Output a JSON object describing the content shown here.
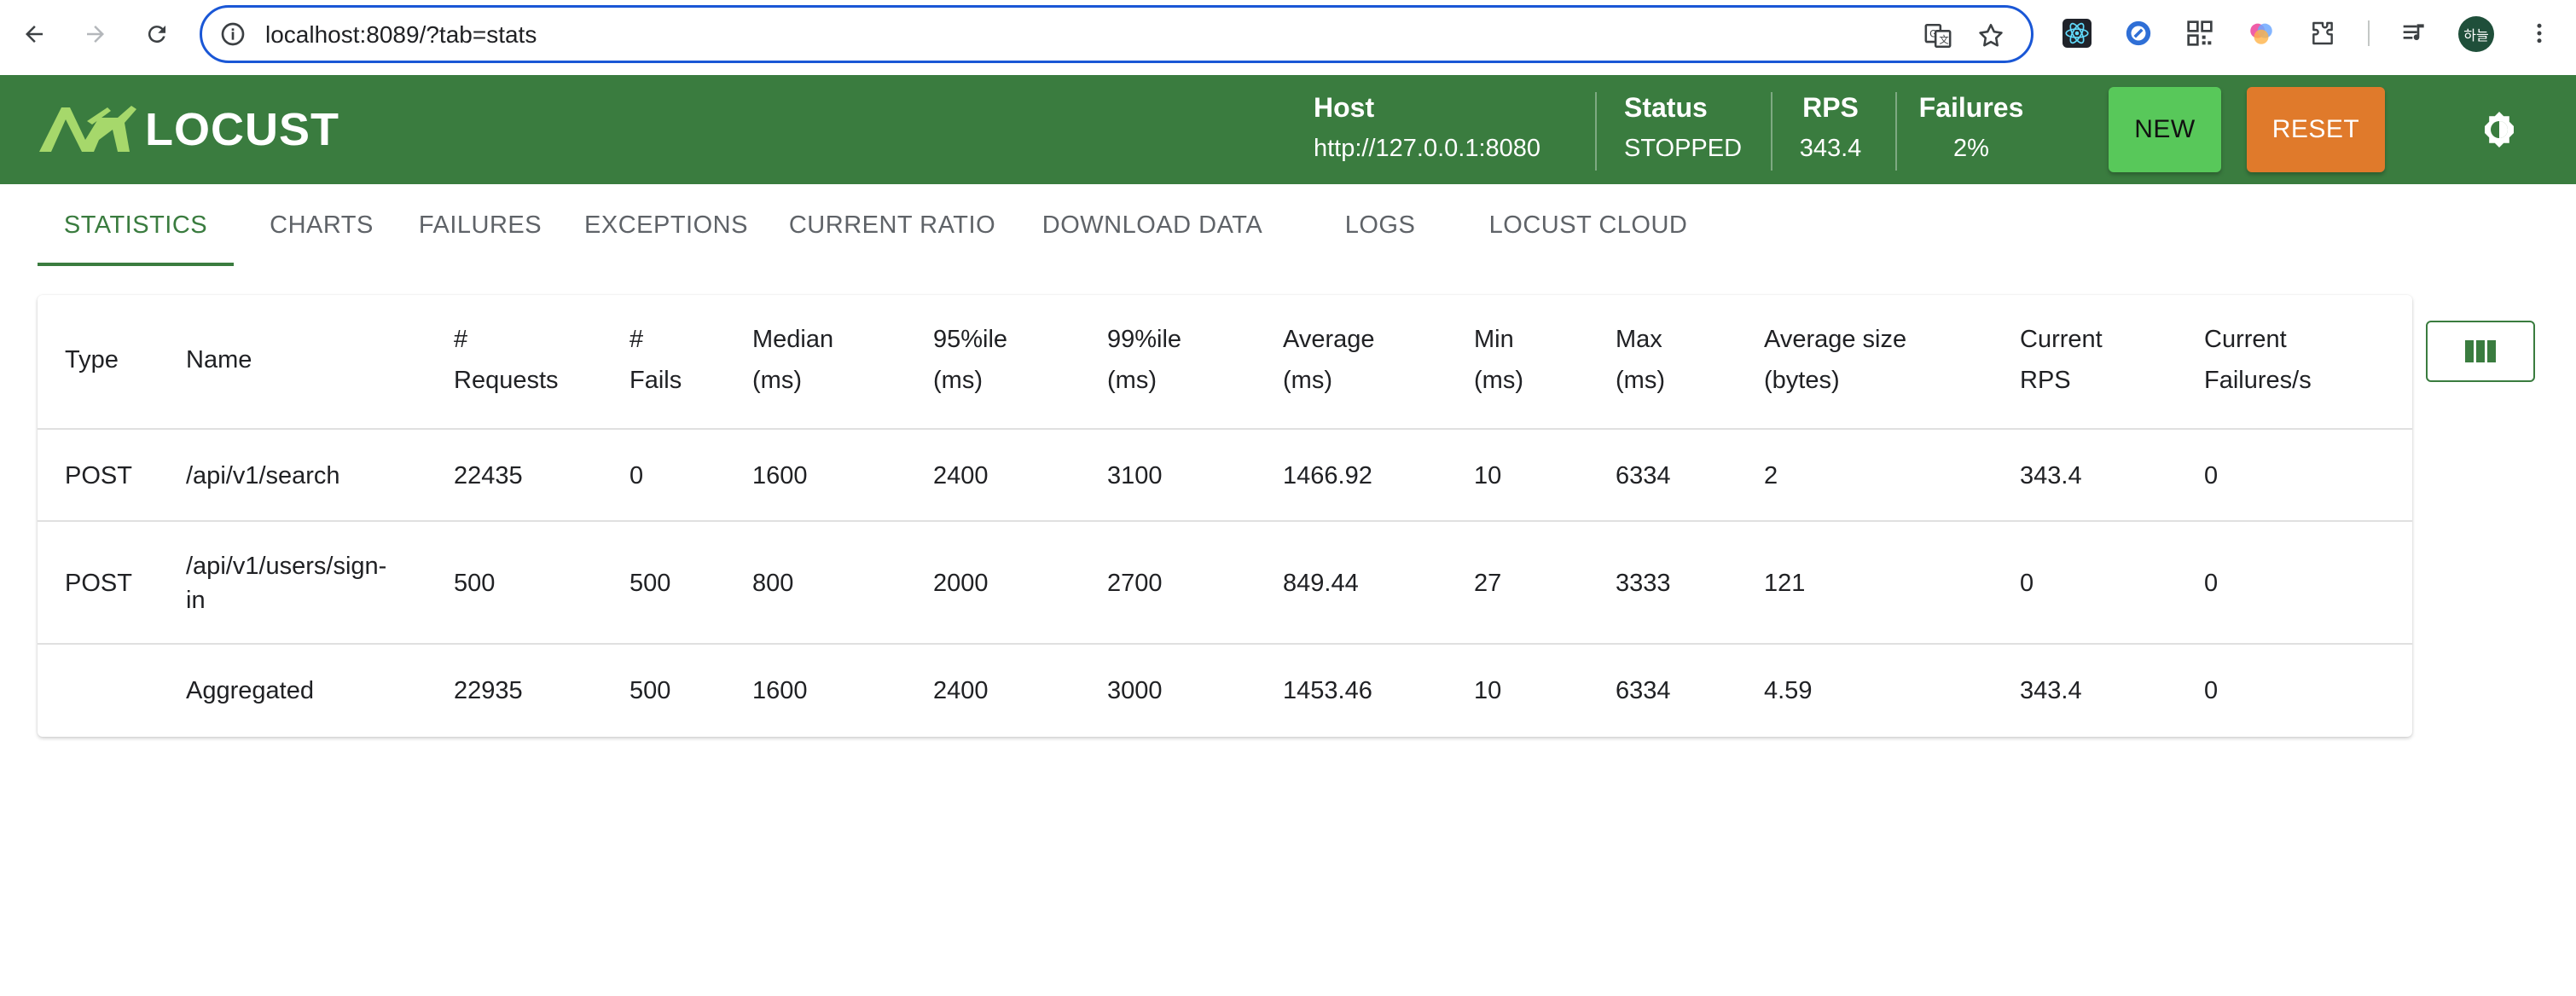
{
  "browser": {
    "url": "localhost:8089/?tab=stats",
    "avatar_text": "하늘"
  },
  "app": {
    "brand": "LOCUST",
    "stats": [
      {
        "label": "Host",
        "value": "http://127.0.0.1:8080"
      },
      {
        "label": "Status",
        "value": "STOPPED"
      },
      {
        "label": "RPS",
        "value": "343.4"
      },
      {
        "label": "Failures",
        "value": "2%"
      }
    ],
    "new_button": "NEW",
    "reset_button": "RESET"
  },
  "tabs": [
    {
      "label": "STATISTICS",
      "active": true
    },
    {
      "label": "CHARTS"
    },
    {
      "label": "FAILURES"
    },
    {
      "label": "EXCEPTIONS"
    },
    {
      "label": "CURRENT RATIO"
    },
    {
      "label": "DOWNLOAD DATA"
    },
    {
      "label": "LOGS"
    },
    {
      "label": "LOCUST CLOUD"
    }
  ],
  "table": {
    "headers": [
      [
        "Type"
      ],
      [
        "Name"
      ],
      [
        "#",
        "Requests"
      ],
      [
        "#",
        "Fails"
      ],
      [
        "Median",
        "(ms)"
      ],
      [
        "95%ile",
        "(ms)"
      ],
      [
        "99%ile",
        "(ms)"
      ],
      [
        "Average",
        "(ms)"
      ],
      [
        "Min",
        "(ms)"
      ],
      [
        "Max",
        "(ms)"
      ],
      [
        "Average size",
        "(bytes)"
      ],
      [
        "Current",
        "RPS"
      ],
      [
        "Current",
        "Failures/s"
      ]
    ],
    "rows": [
      [
        "POST",
        "/api/v1/search",
        "22435",
        "0",
        "1600",
        "2400",
        "3100",
        "1466.92",
        "10",
        "6334",
        "2",
        "343.4",
        "0"
      ],
      [
        "POST",
        "/api/v1/users/sign-\nin",
        "500",
        "500",
        "800",
        "2000",
        "2700",
        "849.44",
        "27",
        "3333",
        "121",
        "0",
        "0"
      ],
      [
        "",
        "Aggregated",
        "22935",
        "500",
        "1600",
        "2400",
        "3000",
        "1453.46",
        "10",
        "6334",
        "4.59",
        "343.4",
        "0"
      ]
    ]
  },
  "colors": {
    "header_green": "#3a7c3f",
    "new_button": "#58c85a",
    "reset_button": "#e07a2b",
    "omnibox_border": "#1a57d6"
  }
}
